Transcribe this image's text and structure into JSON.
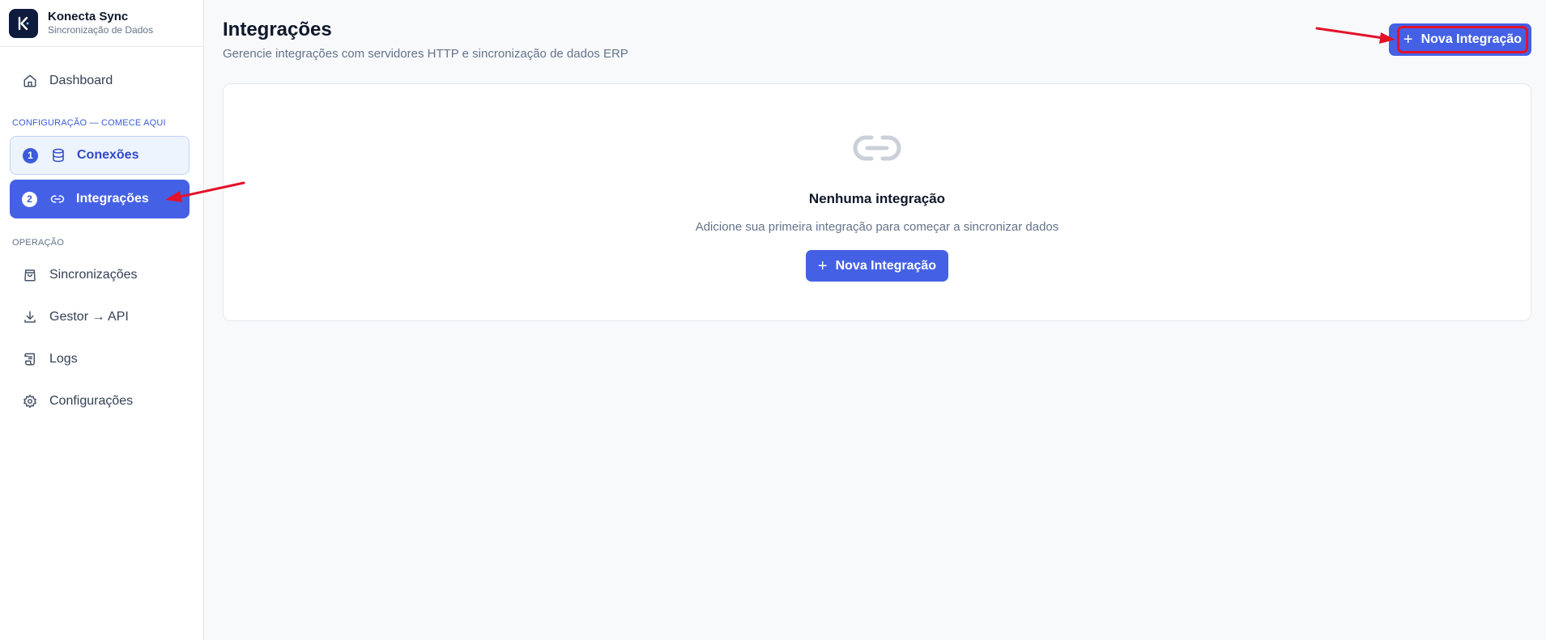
{
  "app": {
    "title": "Konecta Sync",
    "subtitle": "Sincronização de Dados",
    "logo_letter": "K"
  },
  "sidebar": {
    "dashboard": {
      "label": "Dashboard",
      "icon": "home-icon"
    },
    "section_config": "CONFIGURAÇÃO — COMECE AQUI",
    "steps": [
      {
        "number": "1",
        "label": "Conexões",
        "icon": "database-icon"
      },
      {
        "number": "2",
        "label": "Integrações",
        "icon": "link-icon",
        "active": true
      }
    ],
    "section_operation": "OPERAÇÃO",
    "operation_items": [
      {
        "label": "Sincronizações",
        "icon": "shopping-bag-icon"
      },
      {
        "label": "Gestor → API",
        "icon": "download-icon"
      },
      {
        "label": "Logs",
        "icon": "scroll-icon"
      },
      {
        "label": "Configurações",
        "icon": "gear-icon"
      }
    ]
  },
  "page": {
    "title": "Integrações",
    "subtitle": "Gerencie integrações com servidores HTTP e sincronização de dados ERP",
    "new_button_label": "Nova Integração"
  },
  "empty_state": {
    "icon": "link-icon",
    "title": "Nenhuma integração",
    "description": "Adicione sua primeira integração para começar a sincronizar dados",
    "button_label": "Nova Integração"
  },
  "colors": {
    "accent": "#4461e6",
    "brand_dark": "#0f1b3d",
    "annotation_red": "#e3122b",
    "section_config": "#3b5bdb",
    "section_operation": "#64748b"
  }
}
